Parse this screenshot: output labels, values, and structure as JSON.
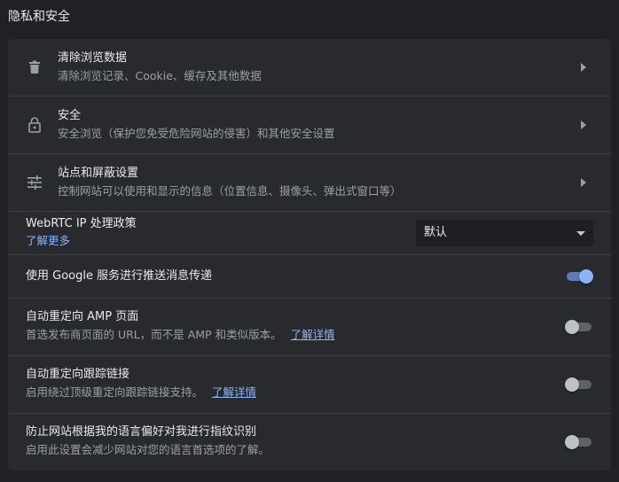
{
  "section": {
    "title": "隐私和安全"
  },
  "rows": {
    "clear_data": {
      "title": "清除浏览数据",
      "subtitle": "清除浏览记录、Cookie、缓存及其他数据",
      "icon": "trash-icon"
    },
    "security": {
      "title": "安全",
      "subtitle": "安全浏览（保护您免受危险网站的侵害）和其他安全设置",
      "icon": "lock-icon"
    },
    "site_settings": {
      "title": "站点和屏蔽设置",
      "subtitle": "控制网站可以使用和显示的信息（位置信息、摄像头、弹出式窗口等）",
      "icon": "sliders-icon"
    },
    "webrtc": {
      "title": "WebRTC IP 处理政策",
      "learn_more": "了解更多",
      "selected": "默认"
    },
    "push": {
      "title": "使用 Google 服务进行推送消息传递",
      "enabled": true
    },
    "amp": {
      "title": "自动重定向 AMP 页面",
      "subtitle": "首选发布商页面的 URL，而不是 AMP 和类似版本。",
      "link": "了解详情",
      "enabled": false
    },
    "tracking": {
      "title": "自动重定向跟踪链接",
      "subtitle": "启用绕过顶级重定向跟踪链接支持。",
      "link": "了解详情",
      "enabled": false
    },
    "fingerprint": {
      "title": "防止网站根据我的语言偏好对我进行指纹识别",
      "subtitle": "启用此设置会减少网站对您的语言首选项的了解。",
      "enabled": false
    }
  },
  "colors": {
    "background": "#202124",
    "card": "#292a2d",
    "accent": "#8ab4f8",
    "text": "#e8eaed",
    "secondary": "#9aa0a6"
  }
}
